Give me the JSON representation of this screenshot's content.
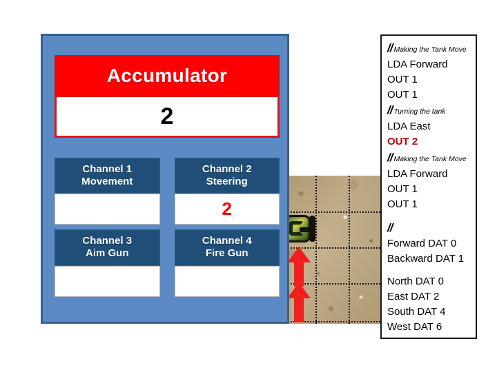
{
  "accumulator": {
    "title": "Accumulator",
    "value": "2",
    "header_color": "#FE0000",
    "value_color": "#000000"
  },
  "channels": [
    {
      "name": "Channel 1",
      "function": "Movement",
      "value": ""
    },
    {
      "name": "Channel 2",
      "function": "Steering",
      "value": "2"
    },
    {
      "name": "Channel 3",
      "function": "Aim Gun",
      "value": ""
    },
    {
      "name": "Channel 4",
      "function": "Fire Gun",
      "value": ""
    }
  ],
  "channel_value_color": "#FE0000",
  "panel_color": "#5B8AC4",
  "channel_header_color": "#1F4E79",
  "code_panel": {
    "highlight_color": "#C00000",
    "lines": [
      {
        "text": "Making the Tank Move",
        "type": "comment"
      },
      {
        "text": "LDA Forward",
        "type": "code"
      },
      {
        "text": "OUT 1",
        "type": "code"
      },
      {
        "text": "OUT 1",
        "type": "code"
      },
      {
        "text": "Turning the tank",
        "type": "comment"
      },
      {
        "text": "LDA East",
        "type": "code"
      },
      {
        "text": "OUT 2",
        "type": "highlight"
      },
      {
        "text": "Making the Tank Move",
        "type": "comment"
      },
      {
        "text": "LDA Forward",
        "type": "code"
      },
      {
        "text": "OUT 1",
        "type": "code"
      },
      {
        "text": "OUT 1",
        "type": "code"
      },
      {
        "text": "",
        "type": "blank"
      },
      {
        "text": "",
        "type": "comment"
      },
      {
        "text": "Forward DAT 0",
        "type": "code"
      },
      {
        "text": "Backward DAT 1",
        "type": "code"
      },
      {
        "text": "",
        "type": "blank"
      },
      {
        "text": "North DAT 0",
        "type": "code"
      },
      {
        "text": "East DAT 2",
        "type": "code"
      },
      {
        "text": "South DAT 4",
        "type": "code"
      },
      {
        "text": "West DAT 6",
        "type": "code"
      }
    ]
  },
  "battlefield": {
    "terrain": "sand-grid",
    "tank": {
      "facing": "east"
    },
    "arrow_color": "#EF2020",
    "arrow_count": 2,
    "arrow_direction": "up"
  }
}
